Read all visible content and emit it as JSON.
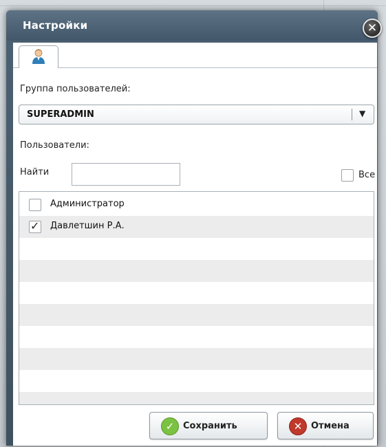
{
  "dialog": {
    "title": "Настройки"
  },
  "tabs": [
    {
      "icon": "user-icon"
    }
  ],
  "group": {
    "label": "Группа пользователей:",
    "selected": "SUPERADMIN"
  },
  "users": {
    "label": "Пользователи:",
    "search_label": "Найти",
    "search_value": "",
    "search_placeholder": "",
    "all_label": "Все",
    "all_checked": false,
    "items": [
      {
        "name": "Администратор",
        "checked": false
      },
      {
        "name": "Давлетшин Р.А.",
        "checked": true
      }
    ]
  },
  "buttons": {
    "save": "Сохранить",
    "cancel": "Отмена"
  },
  "colors": {
    "titlebar": "#4c6172",
    "save_icon": "#7cc242",
    "cancel_icon": "#c0392b",
    "row_alt": "#ececec"
  }
}
